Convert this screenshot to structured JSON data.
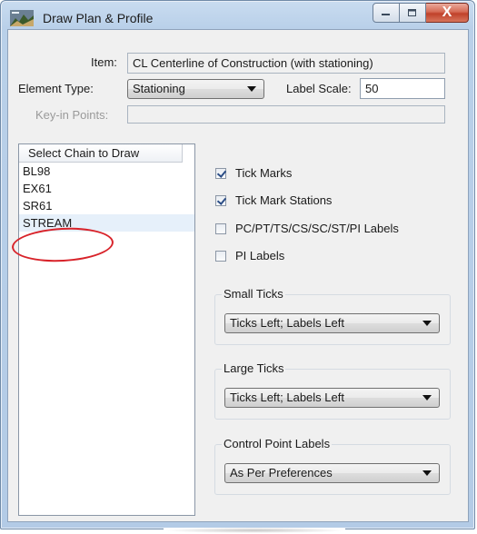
{
  "window": {
    "title": "Draw Plan & Profile",
    "close_glyph": "X",
    "minimize_icon": "minimize-icon",
    "maximize_icon": "maximize-icon"
  },
  "form": {
    "item_label": "Item:",
    "item_value": "CL Centerline of Construction (with stationing)",
    "element_type_label": "Element Type:",
    "element_type_value": "Stationing",
    "label_scale_label": "Label Scale:",
    "label_scale_value": "50",
    "keyin_label": "Key-in Points:",
    "keyin_value": ""
  },
  "chain_list": {
    "header": "Select Chain to Draw",
    "items": [
      "BL98",
      "EX61",
      "SR61",
      "STREAM"
    ],
    "selected": "STREAM"
  },
  "checkboxes": [
    {
      "label": "Tick Marks",
      "checked": true
    },
    {
      "label": "Tick Mark Stations",
      "checked": true
    },
    {
      "label": "PC/PT/TS/CS/SC/ST/PI Labels",
      "checked": false
    },
    {
      "label": "PI Labels",
      "checked": false
    }
  ],
  "groups": {
    "small_ticks": {
      "title": "Small Ticks",
      "value": "Ticks Left; Labels Left"
    },
    "large_ticks": {
      "title": "Large Ticks",
      "value": "Ticks Left; Labels Left"
    },
    "control_point": {
      "title": "Control Point Labels",
      "value": "As Per Preferences"
    }
  },
  "colors": {
    "annotation": "#d8232a",
    "selection": "#e6f0fa",
    "title_bar": "#b9d0e9"
  }
}
